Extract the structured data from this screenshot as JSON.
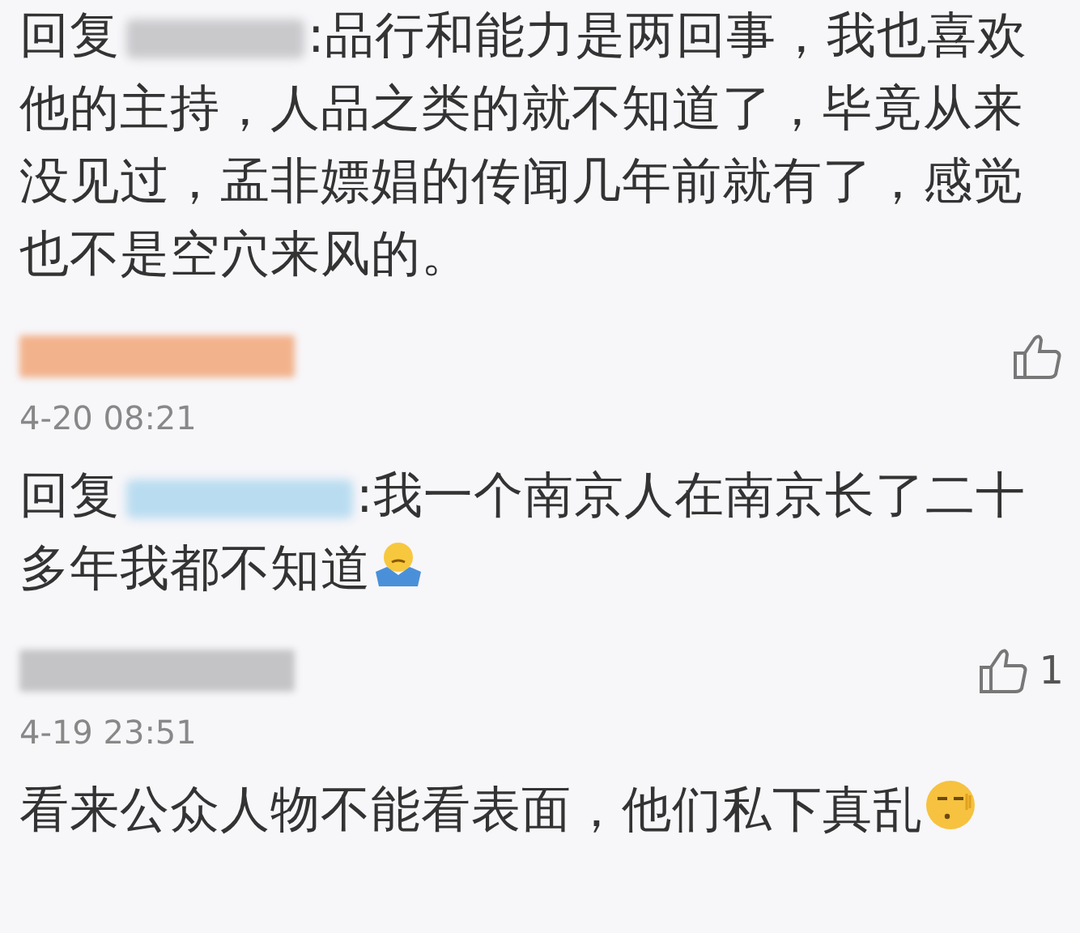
{
  "items": [
    {
      "kind": "reply",
      "prefix": "回复",
      "text": ":品行和能力是两回事，我也喜欢他的主持，人品之类的就不知道了，毕竟从来没见过，孟非嫖娼的传闻几年前就有了，感觉也不是空穴来风的。",
      "color": "#c9c9cc"
    },
    {
      "kind": "meta",
      "color": "#f2b28c",
      "time": "4-20 08:21"
    },
    {
      "kind": "reply",
      "prefix": "回复",
      "text": ":我一个南京人在南京长了二十多年我都不知道",
      "emoji": {
        "kind": "shrug"
      },
      "color": "#b9dcf0"
    },
    {
      "kind": "meta",
      "color": "#c4c4c6",
      "likes": "1",
      "time": "4-19 23:51"
    },
    {
      "kind": "comment",
      "text": "看来公众人物不能看表面，他们私下真乱",
      "emoji": {
        "kind": "smirk"
      }
    }
  ]
}
